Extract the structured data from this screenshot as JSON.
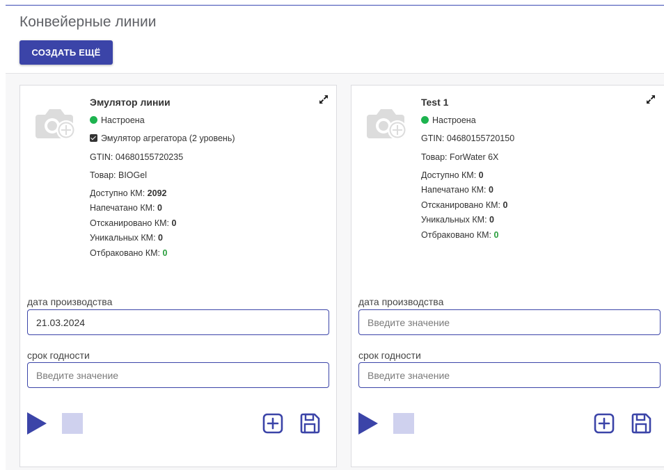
{
  "page": {
    "title": "Конвейерные линии",
    "create_button": "СОЗДАТЬ ЕЩЁ"
  },
  "colors": {
    "accent": "#3b44a8",
    "status_ok": "#1db34f",
    "stop_disabled": "#cfd1ee"
  },
  "lines": [
    {
      "name": "Эмулятор линии",
      "status": "Настроена",
      "aggregator": "Эмулятор агрегатора (2 уровень)",
      "gtin_label": "GTIN:",
      "gtin": "04680155720235",
      "product_label": "Товар:",
      "product": "BIOGel",
      "available_label": "Доступно КМ:",
      "available": "2092",
      "printed_label": "Напечатано КМ:",
      "printed": "0",
      "scanned_label": "Отсканировано КМ:",
      "scanned": "0",
      "unique_label": "Уникальных КМ:",
      "unique": "0",
      "rejected_label": "Отбраковано КМ:",
      "rejected": "0",
      "production_date_label": "дата производства",
      "production_date_value": "21.03.2024",
      "production_date_placeholder": "Введите значение",
      "expiry_label": "срок годности",
      "expiry_value": "",
      "expiry_placeholder": "Введите значение"
    },
    {
      "name": "Test 1",
      "status": "Настроена",
      "gtin_label": "GTIN:",
      "gtin": "04680155720150",
      "product_label": "Товар:",
      "product": "ForWater 6X",
      "available_label": "Доступно КМ:",
      "available": "0",
      "printed_label": "Напечатано КМ:",
      "printed": "0",
      "scanned_label": "Отсканировано КМ:",
      "scanned": "0",
      "unique_label": "Уникальных КМ:",
      "unique": "0",
      "rejected_label": "Отбраковано КМ:",
      "rejected": "0",
      "production_date_label": "дата производства",
      "production_date_value": "",
      "production_date_placeholder": "Введите значение",
      "expiry_label": "срок годности",
      "expiry_value": "",
      "expiry_placeholder": "Введите значение"
    }
  ],
  "icons": {
    "photo": "add-photo-icon",
    "expand": "expand-icon",
    "play": "play-icon",
    "stop": "stop-icon",
    "add": "add-square-icon",
    "save": "save-icon"
  }
}
